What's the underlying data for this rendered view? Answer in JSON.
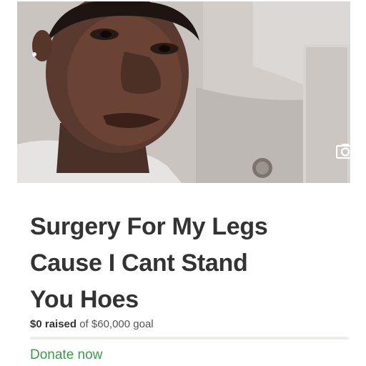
{
  "campaign": {
    "photo_count": "1",
    "title_lines": [
      "Surgery For My Legs",
      "Cause I Cant Stand",
      "You Hoes"
    ],
    "raised_amount": "$0 raised",
    "goal_text": "of $60,000 goal",
    "progress_fraction": 0,
    "donate_label": "Donate now"
  },
  "icons": {
    "camera": "camera-icon"
  },
  "colors": {
    "title": "#333333",
    "donate": "#3e9a4b",
    "progress_fill": "#4da63d"
  }
}
